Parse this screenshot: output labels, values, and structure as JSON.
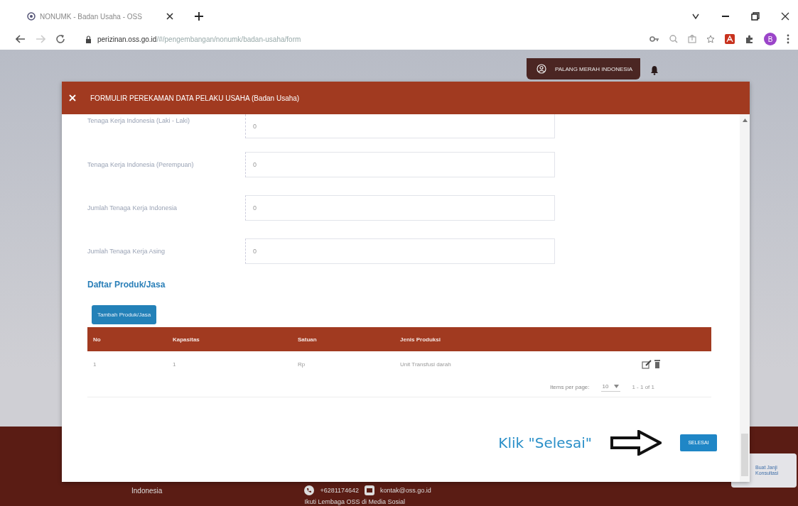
{
  "browser": {
    "tab_title": "NONUMK - Badan Usaha - OSS",
    "url_host": "perizinan.oss.go.id",
    "url_path": "/#/pengembangan/nonumk/badan-usaha/form",
    "profile_initial": "B"
  },
  "header": {
    "user_name": "PALANG MERAH INDONESIA"
  },
  "modal": {
    "title": "FORMULIR PEREKAMAN DATA PELAKU USAHA (Badan Usaha)",
    "fields": [
      {
        "label": "Tenaga Kerja Indonesia (Laki - Laki)",
        "value": "0"
      },
      {
        "label": "Tenaga Kerja Indonesia (Perempuan)",
        "value": "0"
      },
      {
        "label": "Jumlah Tenaga Kerja Indonesia",
        "value": "0"
      },
      {
        "label": "Jumlah Tenaga Kerja Asing",
        "value": "0"
      }
    ],
    "section_title": "Daftar Produk/Jasa",
    "add_button": "Tambah Produk/Jasa",
    "table": {
      "columns": [
        "No",
        "Kapasitas",
        "Satuan",
        "Jenis Produksi"
      ],
      "rows": [
        [
          "1",
          "1",
          "Rp",
          "Unit Transfusi darah"
        ]
      ]
    },
    "pagination": {
      "label": "Items per page:",
      "page_size": "10",
      "range": "1 - 1 of 1"
    },
    "annotation": "Klik \"Selesai\"",
    "submit_button": "SELESAI"
  },
  "footer": {
    "country": "Indonesia",
    "phone": "+6281174642",
    "email": "kontak@oss.go.id",
    "social": "Ikuti Lembaga OSS di Media Sosial"
  },
  "help_widget": {
    "label": "Buat Janji Konsultasi"
  }
}
